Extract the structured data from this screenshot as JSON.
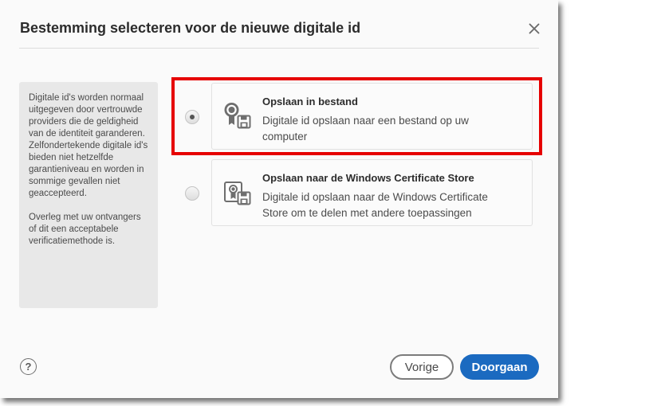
{
  "dialog": {
    "title": "Bestemming selecteren voor de nieuwe digitale id",
    "close_icon": "close-icon"
  },
  "info_panel": {
    "paragraph_1": "Digitale id's worden normaal uitgegeven door vertrouwde providers die de geldigheid van de identiteit garanderen. Zelfondertekende digitale id's bieden niet hetzelfde garantieniveau en worden in sommige gevallen niet geaccepteerd.",
    "paragraph_2": "Overleg met uw ontvangers of dit een acceptabele verificatiemethode is."
  },
  "options": [
    {
      "title": "Opslaan in bestand",
      "description": "Digitale id opslaan naar een bestand op uw computer",
      "selected": true,
      "icon": "certificate-file-icon"
    },
    {
      "title": "Opslaan naar de Windows Certificate Store",
      "description": "Digitale id opslaan naar de Windows Certificate Store om te delen met andere toepassingen",
      "selected": false,
      "icon": "certificate-store-icon"
    }
  ],
  "footer": {
    "help_label": "?",
    "back_label": "Vorige",
    "continue_label": "Doorgaan"
  },
  "colors": {
    "highlight": "#e60000",
    "primary_button": "#1b6ac0",
    "dialog_background": "#fafafa",
    "info_panel_background": "#e8e8e8"
  }
}
